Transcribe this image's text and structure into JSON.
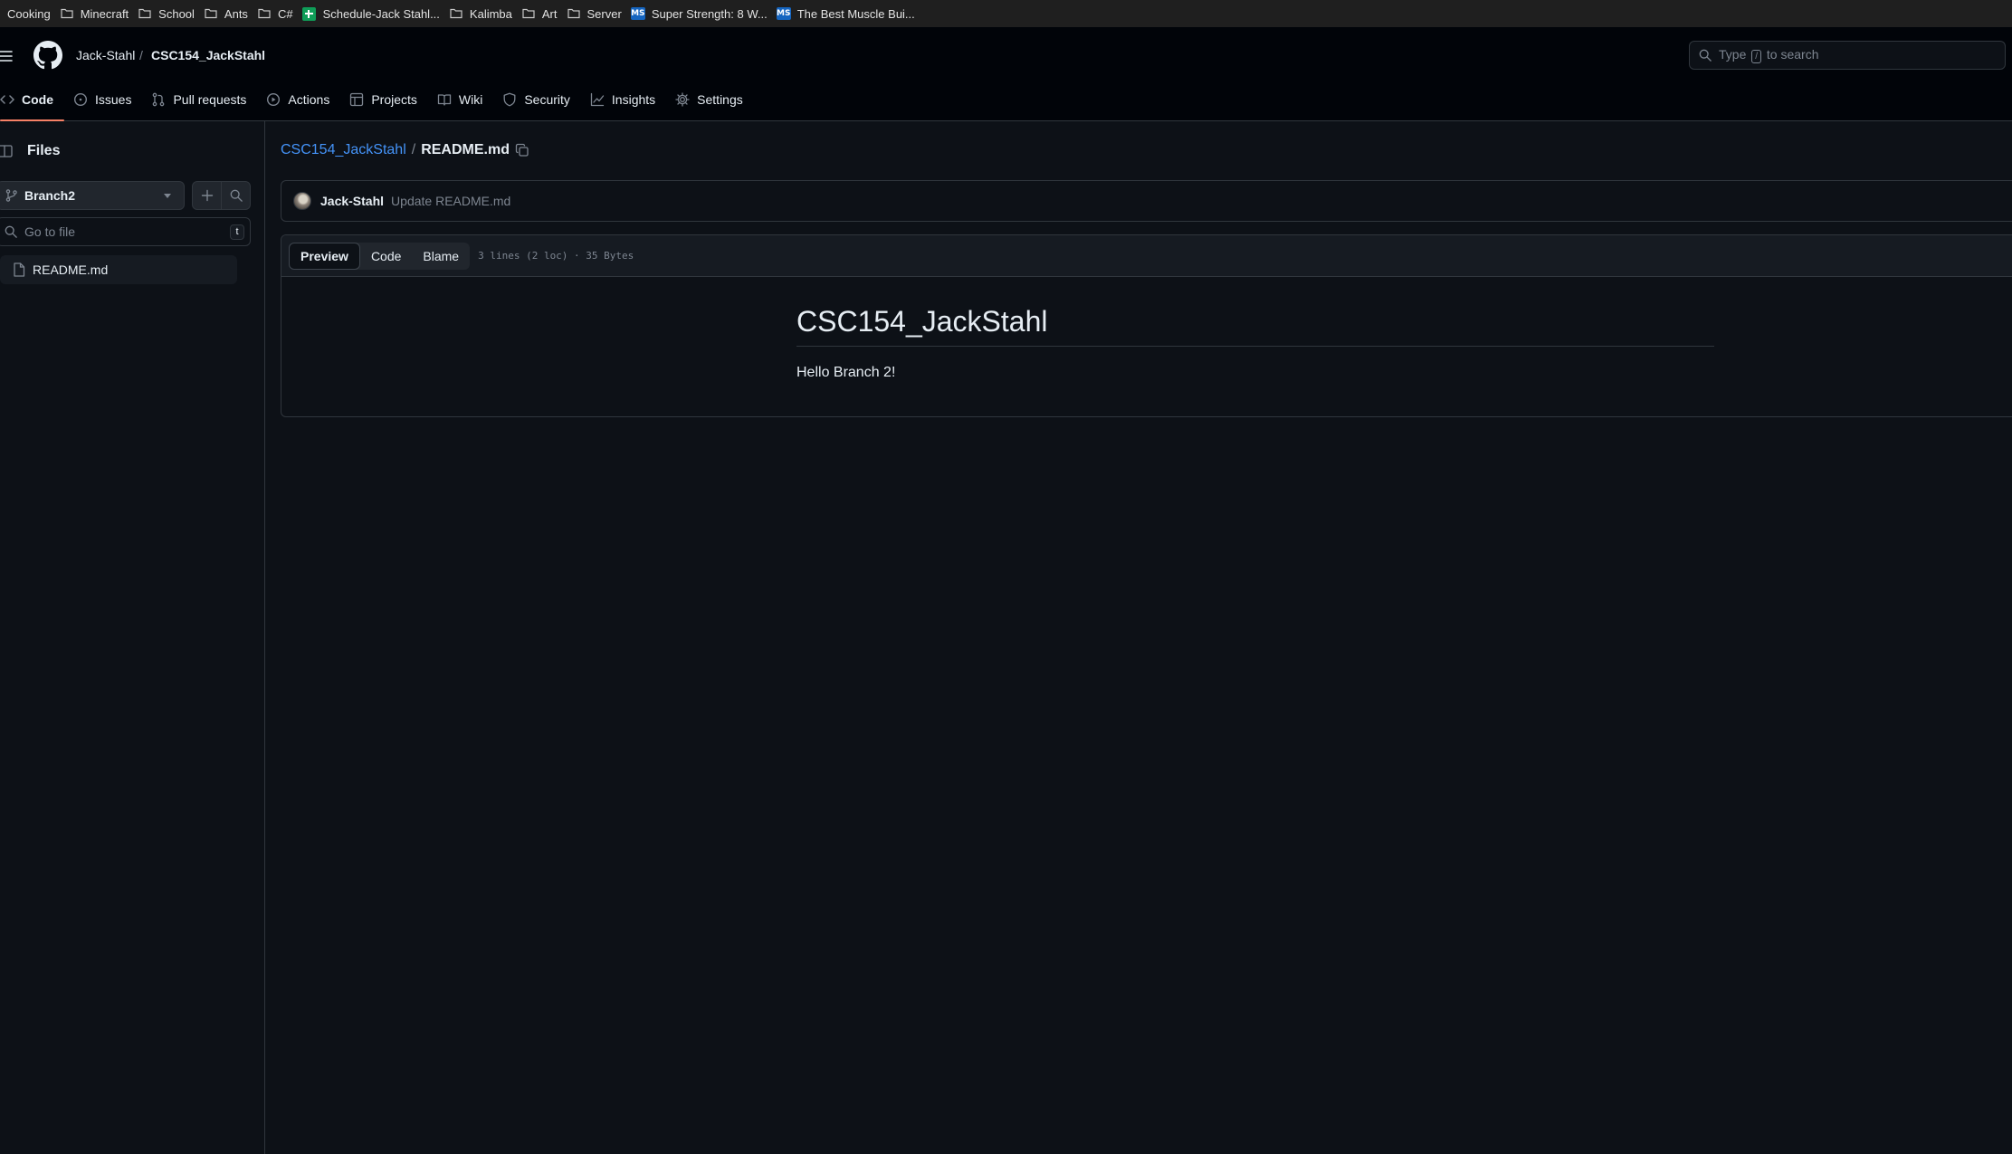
{
  "bookmarks": [
    {
      "label": "Cooking",
      "icon": "none"
    },
    {
      "label": "Minecraft",
      "icon": "folder-icon"
    },
    {
      "label": "School",
      "icon": "folder-icon"
    },
    {
      "label": "Ants",
      "icon": "folder-icon"
    },
    {
      "label": "C#",
      "icon": "folder-icon"
    },
    {
      "label": "Schedule-Jack Stahl...",
      "icon": "sheets-icon"
    },
    {
      "label": "Kalimba",
      "icon": "folder-icon"
    },
    {
      "label": "Art",
      "icon": "folder-icon"
    },
    {
      "label": "Server",
      "icon": "folder-icon"
    },
    {
      "label": "Super Strength: 8 W...",
      "icon": "ms-icon"
    },
    {
      "label": "The Best Muscle Bui...",
      "icon": "ms-icon"
    }
  ],
  "header": {
    "owner": "Jack-Stahl",
    "separator": "/",
    "repo": "CSC154_JackStahl",
    "search": {
      "prefix": "Type",
      "key": "/",
      "suffix": "to search"
    }
  },
  "tabs": [
    {
      "label": "Code",
      "icon": "code-icon",
      "active": true
    },
    {
      "label": "Issues",
      "icon": "issue-icon"
    },
    {
      "label": "Pull requests",
      "icon": "pull-request-icon"
    },
    {
      "label": "Actions",
      "icon": "play-icon"
    },
    {
      "label": "Projects",
      "icon": "table-icon"
    },
    {
      "label": "Wiki",
      "icon": "book-icon"
    },
    {
      "label": "Security",
      "icon": "shield-icon"
    },
    {
      "label": "Insights",
      "icon": "graph-icon"
    },
    {
      "label": "Settings",
      "icon": "gear-icon"
    }
  ],
  "sidebar": {
    "title": "Files",
    "branch": "Branch2",
    "goto_placeholder": "Go to file",
    "goto_shortcut": "t",
    "files": [
      {
        "name": "README.md"
      }
    ]
  },
  "main": {
    "path_repo": "CSC154_JackStahl",
    "path_sep": "/",
    "path_file": "README.md",
    "commit": {
      "author": "Jack-Stahl",
      "message": "Update README.md"
    },
    "view_tabs": [
      {
        "label": "Preview",
        "selected": true
      },
      {
        "label": "Code"
      },
      {
        "label": "Blame"
      }
    ],
    "file_meta": "3 lines (2 loc) · 35 Bytes",
    "readme": {
      "heading": "CSC154_JackStahl",
      "body": "Hello Branch 2!"
    }
  },
  "colors": {
    "background": "#0d1117",
    "header_bg": "#010409",
    "border": "#30363d",
    "link": "#4493f8",
    "active_tab_underline": "#f78166",
    "muted_text": "#7d8590"
  }
}
